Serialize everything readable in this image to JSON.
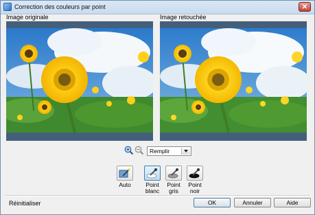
{
  "window": {
    "title": "Correction des couleurs par point",
    "close_icon": "close-icon"
  },
  "images": {
    "original_label": "Image originale",
    "retouched_label": "Image retouchée"
  },
  "zoom": {
    "in_icon": "zoom-in-icon",
    "out_icon": "zoom-out-icon"
  },
  "fill_mode": {
    "selected": "Remplir"
  },
  "tools": {
    "auto": "Auto",
    "white_point_1": "Point",
    "white_point_2": "blanc",
    "gray_point_1": "Point",
    "gray_point_2": "gris",
    "black_point_1": "Point",
    "black_point_2": "noir"
  },
  "footer": {
    "reset": "Réinitialiser",
    "ok": "OK",
    "cancel": "Annuler",
    "help": "Aide"
  }
}
